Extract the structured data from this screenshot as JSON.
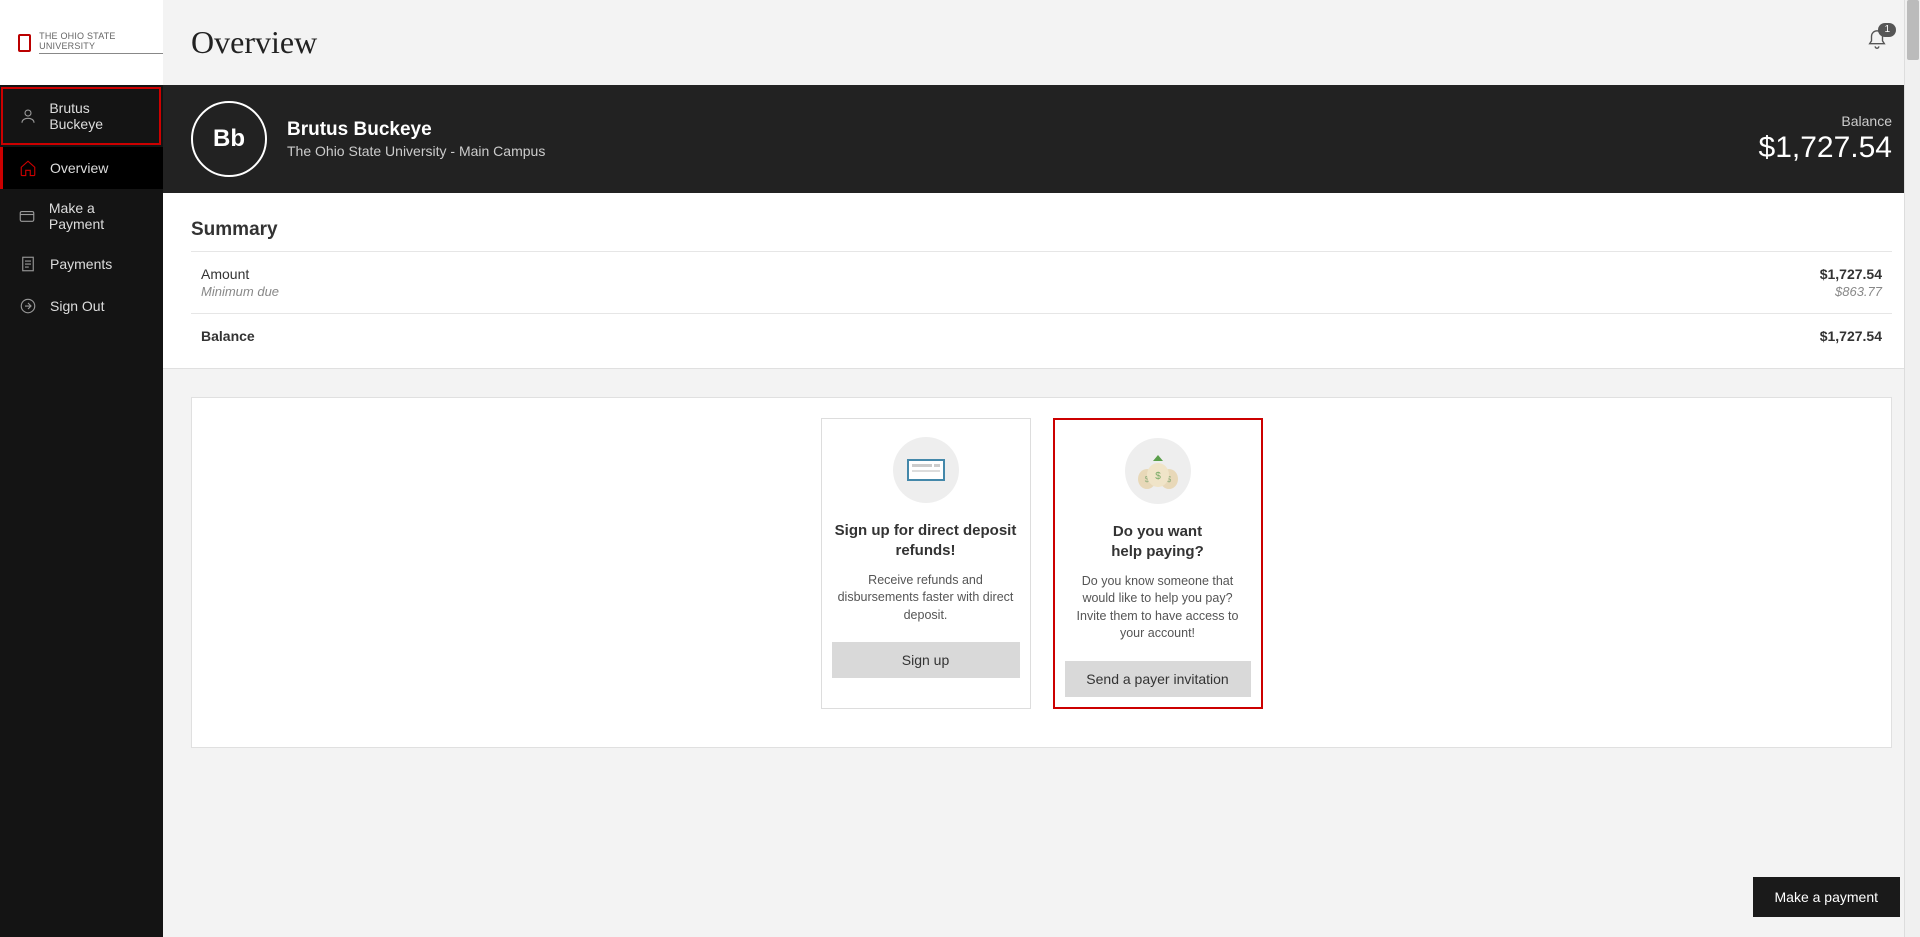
{
  "brand": {
    "name": "The Ohio State University"
  },
  "sidebar": {
    "user_name": "Brutus Buckeye",
    "items": [
      {
        "label": "Overview"
      },
      {
        "label": "Make a Payment"
      },
      {
        "label": "Payments"
      },
      {
        "label": "Sign Out"
      }
    ]
  },
  "header": {
    "title": "Overview",
    "notification_count": "1"
  },
  "profile": {
    "initials": "Bb",
    "name": "Brutus Buckeye",
    "subtitle": "The Ohio State University - Main Campus",
    "balance_label": "Balance",
    "balance_amount": "$1,727.54"
  },
  "summary": {
    "title": "Summary",
    "rows": [
      {
        "label": "Amount",
        "sublabel": "Minimum due",
        "value": "$1,727.54",
        "subvalue": "$863.77"
      },
      {
        "label": "Balance",
        "value": "$1,727.54"
      }
    ]
  },
  "cards": [
    {
      "title": "Sign up for direct deposit\nrefunds!",
      "desc": "Receive refunds and disbursements faster with direct deposit.",
      "button": "Sign up"
    },
    {
      "title": "Do you want\nhelp paying?",
      "desc": "Do you know someone that would like to help you pay? Invite them to have access to your account!",
      "button": "Send a payer invitation"
    }
  ],
  "floating_button": "Make a payment"
}
